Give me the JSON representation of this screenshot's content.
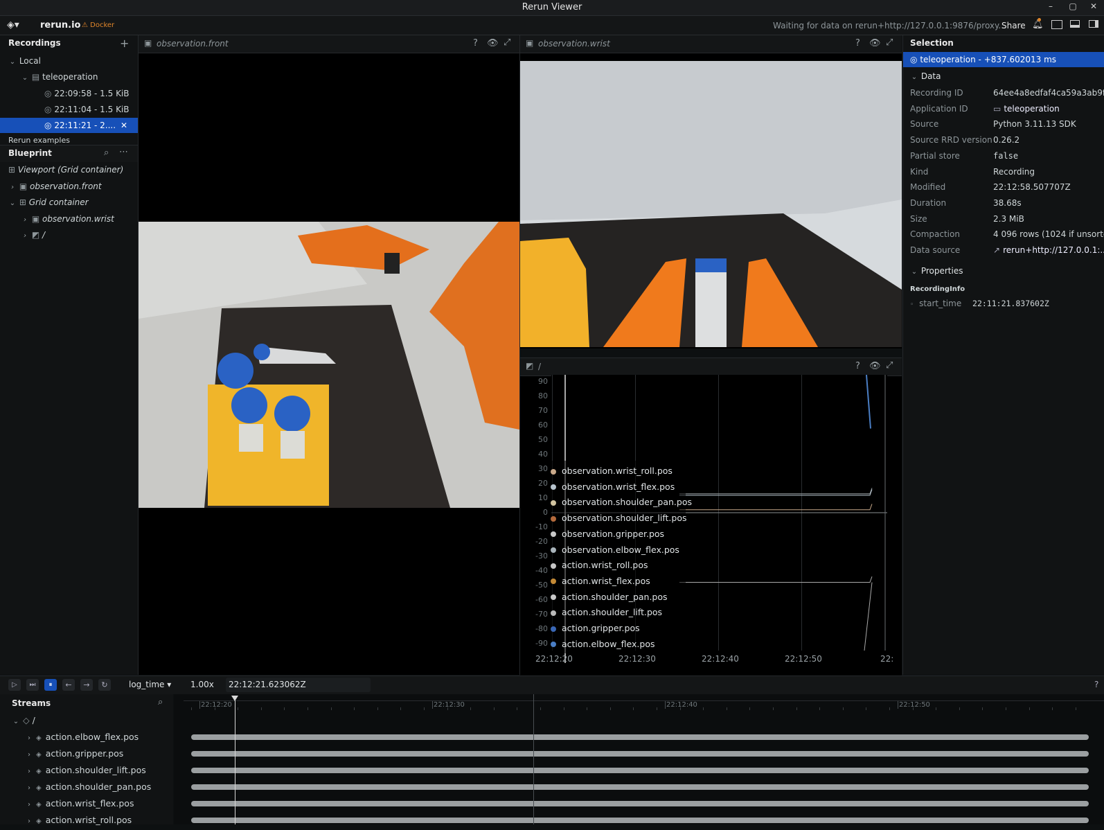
{
  "window": {
    "title": "Rerun Viewer"
  },
  "topbar": {
    "app_name": "rerun.io",
    "badge": "⚠ Docker",
    "status": "Waiting for data on rerun+http://127.0.0.1:9876/proxy...",
    "share": "Share"
  },
  "recordings": {
    "header": "Recordings",
    "local_label": "Local",
    "app_label": "teleoperation",
    "items": [
      "22:09:58 - 1.5 KiB",
      "22:11:04 - 1.5 KiB",
      "22:11:21 - 2...."
    ],
    "examples_label": "Rerun examples"
  },
  "blueprint": {
    "header": "Blueprint",
    "viewport": "Viewport (Grid container)",
    "front": "observation.front",
    "grid": "Grid container",
    "wrist": "observation.wrist",
    "root": "/"
  },
  "views": {
    "front_title": "observation.front",
    "wrist_title": "observation.wrist",
    "plot_title": "/"
  },
  "chart_data": {
    "type": "line",
    "title": "/",
    "x_ticks": [
      "22:12:20",
      "22:12:30",
      "22:12:40",
      "22:12:50",
      "22:"
    ],
    "y_ticks": [
      "90",
      "80",
      "70",
      "60",
      "50",
      "40",
      "30",
      "20",
      "10",
      "0",
      "-10",
      "-20",
      "-30",
      "-40",
      "-50",
      "-60",
      "-70",
      "-80",
      "-90"
    ],
    "ylim": [
      -95,
      95
    ],
    "series": [
      {
        "name": "observation.wrist_roll.pos",
        "color": "#c9a98a"
      },
      {
        "name": "observation.wrist_flex.pos",
        "color": "#b7c3cc"
      },
      {
        "name": "observation.shoulder_pan.pos",
        "color": "#d1c3a0"
      },
      {
        "name": "observation.shoulder_lift.pos",
        "color": "#b46a3c"
      },
      {
        "name": "observation.gripper.pos",
        "color": "#c8c8c8"
      },
      {
        "name": "observation.elbow_flex.pos",
        "color": "#a9b4bb"
      },
      {
        "name": "action.wrist_roll.pos",
        "color": "#c6c6c6"
      },
      {
        "name": "action.wrist_flex.pos",
        "color": "#c48a36"
      },
      {
        "name": "action.shoulder_pan.pos",
        "color": "#c8c8c8"
      },
      {
        "name": "action.shoulder_lift.pos",
        "color": "#b9b9b9"
      },
      {
        "name": "action.gripper.pos",
        "color": "#3a67b5"
      },
      {
        "name": "action.elbow_flex.pos",
        "color": "#4a7ec4"
      }
    ]
  },
  "selection": {
    "header": "Selection",
    "selected": "teleoperation - +837.602013 ms",
    "data_section": "Data",
    "fields": [
      {
        "key": "Recording ID",
        "value": "64ee4a8edfaf4ca59a3ab9f"
      },
      {
        "key": "Application ID",
        "value": "teleoperation"
      },
      {
        "key": "Source",
        "value": "Python 3.11.13 SDK"
      },
      {
        "key": "Source RRD version",
        "value": "0.26.2"
      },
      {
        "key": "Partial store",
        "value": "false"
      },
      {
        "key": "Kind",
        "value": "Recording"
      },
      {
        "key": "Modified",
        "value": "22:12:58.507707Z"
      },
      {
        "key": "Duration",
        "value": "38.68s"
      },
      {
        "key": "Size",
        "value": "2.3 MiB"
      },
      {
        "key": "Compaction",
        "value": "4 096 rows (1024 if unsorte"
      },
      {
        "key": "Data source",
        "value": "rerun+http://127.0.0.1:..."
      }
    ],
    "properties_section": "Properties",
    "recording_info": "RecordingInfo",
    "start_time_key": "start_time",
    "start_time_value": "22:11:21.837602Z"
  },
  "timeline": {
    "timeline_name": "log_time",
    "speed": "1.00x",
    "current_time": "22:12:21.623062Z",
    "ticks": [
      "22:12:20",
      "22:12:30",
      "22:12:40",
      "22:12:50"
    ],
    "help": "?"
  },
  "streams": {
    "header": "Streams",
    "root": "/",
    "items": [
      "action.elbow_flex.pos",
      "action.gripper.pos",
      "action.shoulder_lift.pos",
      "action.shoulder_pan.pos",
      "action.wrist_flex.pos",
      "action.wrist_roll.pos"
    ]
  }
}
